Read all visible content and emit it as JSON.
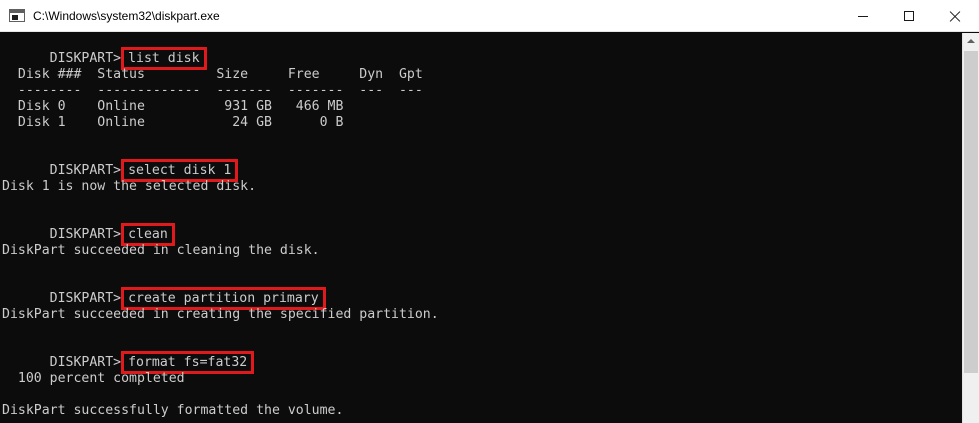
{
  "window": {
    "title": "C:\\Windows\\system32\\diskpart.exe",
    "buttons": [
      "minimize",
      "maximize",
      "close"
    ]
  },
  "console": {
    "prompt": "DISKPART>",
    "highlight_color": "#e0191c",
    "commands": {
      "list_disk": "list disk",
      "select_disk": "select disk 1",
      "clean": "clean",
      "create_partition": "create partition primary",
      "format": "format fs=fat32"
    },
    "disk_table": {
      "header": "  Disk ###  Status         Size     Free     Dyn  Gpt",
      "separator": "  --------  -------------  -------  -------  ---  ---",
      "rows": [
        "  Disk 0    Online          931 GB   466 MB",
        "  Disk 1    Online           24 GB      0 B"
      ]
    },
    "messages": {
      "selected": "Disk 1 is now the selected disk.",
      "cleaned": "DiskPart succeeded in cleaning the disk.",
      "created": "DiskPart succeeded in creating the specified partition.",
      "progress": "  100 percent completed",
      "formatted": "DiskPart successfully formatted the volume."
    }
  }
}
